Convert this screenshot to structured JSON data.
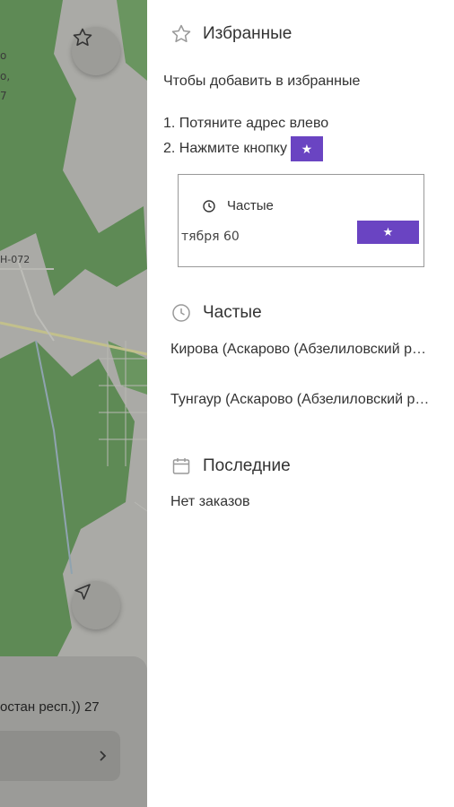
{
  "map": {
    "label_fragments": [
      "о",
      "о,",
      "7"
    ],
    "road_label": "Н-072",
    "star_icon": "star-icon",
    "navigate_icon": "navigation-arrow-icon"
  },
  "address_card": {
    "address_text": "остан респ.)) 27",
    "chevron_icon": "chevron-right-icon"
  },
  "favorites": {
    "title": "Избранные",
    "hint": "Чтобы добавить в избранные",
    "step1": "1. Потяните адрес влево",
    "step2": "2. Нажмите кнопку",
    "star_glyph": "★",
    "demo": {
      "header": "Частые",
      "row_text": "тября 60",
      "star_glyph": "★"
    }
  },
  "frequent": {
    "title": "Частые",
    "items": [
      "Кирова (Аскарово (Абзелиловский р-н))",
      "Тунгаур (Аскарово (Абзелиловский р-н))"
    ]
  },
  "recent": {
    "title": "Последние",
    "empty": "Нет заказов"
  },
  "colors": {
    "accent": "#6a44c2",
    "map_green": "#5e8a55",
    "map_gray": "#a9a9a5"
  }
}
